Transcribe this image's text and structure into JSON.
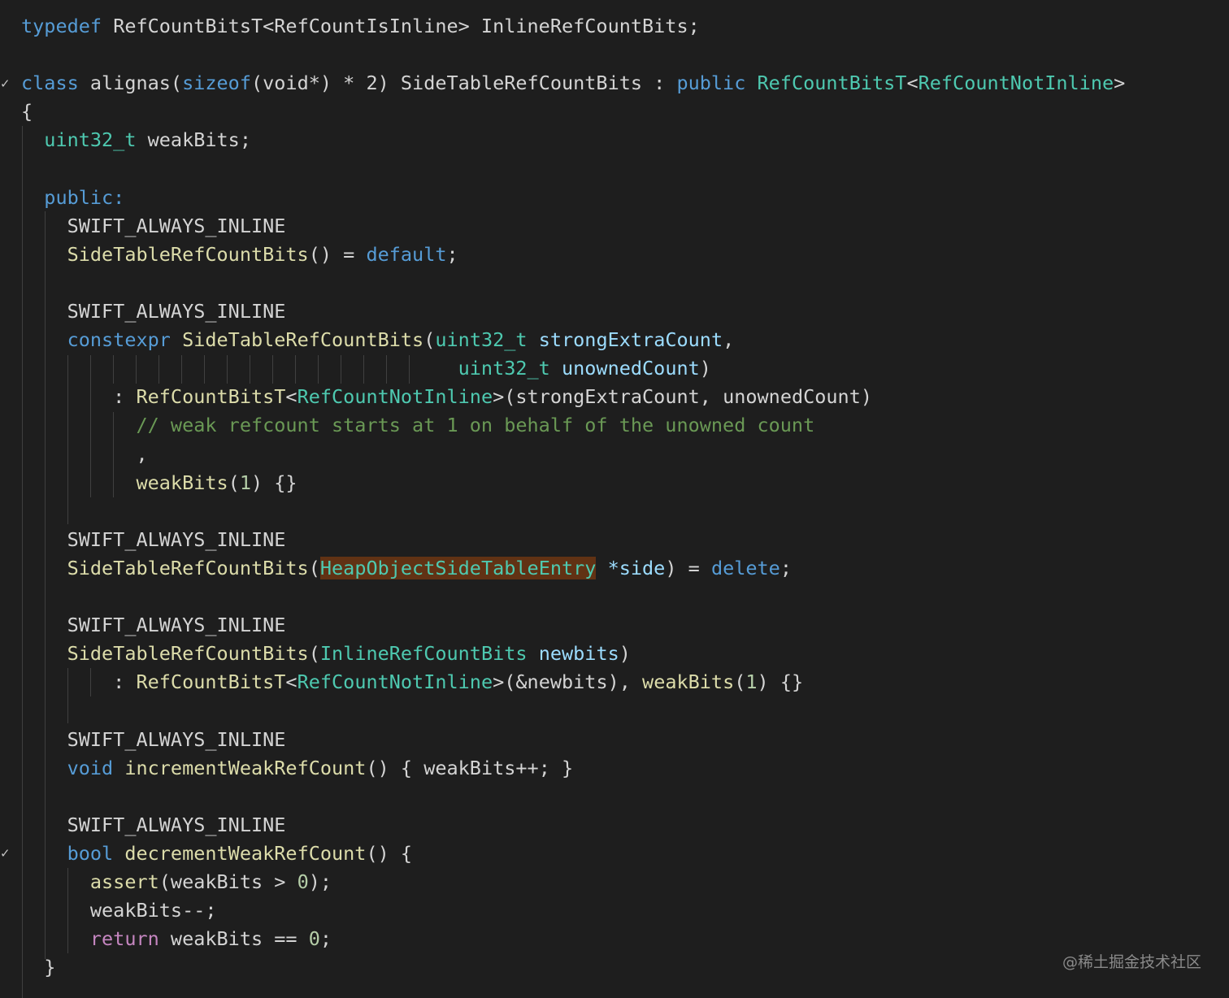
{
  "lines": [
    [
      [
        "k",
        "typedef"
      ],
      [
        "m",
        " RefCountBitsT<RefCountIsInline> InlineRefCountBits;"
      ]
    ],
    [],
    [
      [
        "k",
        "class"
      ],
      [
        "m",
        " alignas("
      ],
      [
        "k",
        "sizeof"
      ],
      [
        "m",
        "(void*) * 2) SideTableRefCountBits : "
      ],
      [
        "k",
        "public"
      ],
      [
        "m",
        " "
      ],
      [
        "t",
        "RefCountBitsT"
      ],
      [
        "m",
        "<"
      ],
      [
        "t",
        "RefCountNotInline"
      ],
      [
        "m",
        ">"
      ]
    ],
    [
      [
        "m",
        "{"
      ]
    ],
    [
      [
        "m",
        "  "
      ],
      [
        "t",
        "uint32_t"
      ],
      [
        "m",
        " weakBits;"
      ]
    ],
    [],
    [
      [
        "m",
        "  "
      ],
      [
        "k",
        "public:"
      ]
    ],
    [
      [
        "m",
        "    SWIFT_ALWAYS_INLINE"
      ]
    ],
    [
      [
        "m",
        "    "
      ],
      [
        "f",
        "SideTableRefCountBits"
      ],
      [
        "m",
        "() = "
      ],
      [
        "k",
        "default"
      ],
      [
        "m",
        ";"
      ]
    ],
    [],
    [
      [
        "m",
        "    SWIFT_ALWAYS_INLINE"
      ]
    ],
    [
      [
        "m",
        "    "
      ],
      [
        "k",
        "constexpr"
      ],
      [
        "m",
        " "
      ],
      [
        "f",
        "SideTableRefCountBits"
      ],
      [
        "m",
        "("
      ],
      [
        "t",
        "uint32_t"
      ],
      [
        "m",
        " "
      ],
      [
        "p",
        "strongExtraCount"
      ],
      [
        "m",
        ","
      ]
    ],
    [
      [
        "m",
        "                                      "
      ],
      [
        "t",
        "uint32_t"
      ],
      [
        "m",
        " "
      ],
      [
        "p",
        "unownedCount"
      ],
      [
        "m",
        ")"
      ]
    ],
    [
      [
        "m",
        "        : "
      ],
      [
        "f",
        "RefCountBitsT"
      ],
      [
        "m",
        "<"
      ],
      [
        "t",
        "RefCountNotInline"
      ],
      [
        "m",
        ">(strongExtraCount, unownedCount)"
      ]
    ],
    [
      [
        "m",
        "          "
      ],
      [
        "c",
        "// weak refcount starts at 1 on behalf of the unowned count"
      ]
    ],
    [
      [
        "m",
        "          ,"
      ]
    ],
    [
      [
        "m",
        "          "
      ],
      [
        "f",
        "weakBits"
      ],
      [
        "m",
        "("
      ],
      [
        "n",
        "1"
      ],
      [
        "m",
        ") {}"
      ]
    ],
    [],
    [
      [
        "m",
        "    SWIFT_ALWAYS_INLINE"
      ]
    ],
    [
      [
        "m",
        "    "
      ],
      [
        "f",
        "SideTableRefCountBits"
      ],
      [
        "m",
        "("
      ],
      [
        "hl",
        "HeapObjectSideTableEntry"
      ],
      [
        "m",
        " "
      ],
      [
        "p",
        "*side"
      ],
      [
        "m",
        ") = "
      ],
      [
        "k",
        "delete"
      ],
      [
        "m",
        ";"
      ]
    ],
    [],
    [
      [
        "m",
        "    SWIFT_ALWAYS_INLINE"
      ]
    ],
    [
      [
        "m",
        "    "
      ],
      [
        "f",
        "SideTableRefCountBits"
      ],
      [
        "m",
        "("
      ],
      [
        "t",
        "InlineRefCountBits"
      ],
      [
        "m",
        " "
      ],
      [
        "p",
        "newbits"
      ],
      [
        "m",
        ")"
      ]
    ],
    [
      [
        "m",
        "        : "
      ],
      [
        "f",
        "RefCountBitsT"
      ],
      [
        "m",
        "<"
      ],
      [
        "t",
        "RefCountNotInline"
      ],
      [
        "m",
        ">(&newbits), "
      ],
      [
        "f",
        "weakBits"
      ],
      [
        "m",
        "("
      ],
      [
        "n",
        "1"
      ],
      [
        "m",
        ") {}"
      ]
    ],
    [],
    [
      [
        "m",
        "    SWIFT_ALWAYS_INLINE"
      ]
    ],
    [
      [
        "m",
        "    "
      ],
      [
        "k",
        "void"
      ],
      [
        "m",
        " "
      ],
      [
        "f",
        "incrementWeakRefCount"
      ],
      [
        "m",
        "() { weakBits++; }"
      ]
    ],
    [],
    [
      [
        "m",
        "    SWIFT_ALWAYS_INLINE"
      ]
    ],
    [
      [
        "m",
        "    "
      ],
      [
        "k",
        "bool"
      ],
      [
        "m",
        " "
      ],
      [
        "f",
        "decrementWeakRefCount"
      ],
      [
        "m",
        "() {"
      ]
    ],
    [
      [
        "m",
        "      "
      ],
      [
        "f",
        "assert"
      ],
      [
        "m",
        "(weakBits > "
      ],
      [
        "n",
        "0"
      ],
      [
        "m",
        ");"
      ]
    ],
    [
      [
        "m",
        "      weakBits--;"
      ]
    ],
    [
      [
        "m",
        "      "
      ],
      [
        "r",
        "return"
      ],
      [
        "m",
        " weakBits == "
      ],
      [
        "n",
        "0"
      ],
      [
        "m",
        ";"
      ]
    ],
    [
      [
        "m",
        "  }"
      ]
    ]
  ],
  "fold_icons": [
    "chevron-down-icon",
    "chevron-down-icon"
  ],
  "watermark": "@稀土掘金技术社区"
}
